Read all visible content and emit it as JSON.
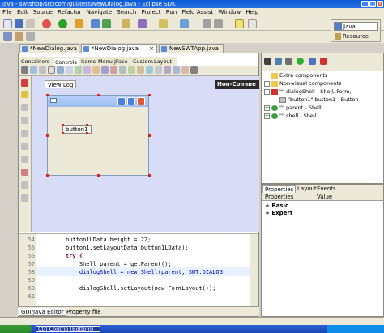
{
  "window": {
    "title": "Java - swtshop/src/com/gui/test/NewDialog.java - Eclipse SDK"
  },
  "menu": [
    "File",
    "Edit",
    "Source",
    "Refactor",
    "Navigate",
    "Search",
    "Project",
    "Run",
    "Field Assist",
    "Window",
    "Help"
  ],
  "perspectives": {
    "java": "Java",
    "resource": "Resource"
  },
  "editor_tabs": [
    "*NewDialog.java",
    "*NewDialog.java",
    "NewSWTApp.java"
  ],
  "palette_tabs": [
    "Containers",
    "Controls",
    "Items",
    "Menu",
    "JFace",
    "Custom",
    "Layout"
  ],
  "canvas": {
    "view_log_label": "View Log",
    "non_commercial_label": "Non-Comme",
    "button_label": "button1"
  },
  "code": {
    "lines": [
      {
        "num": "54",
        "text": "button1LData.height = 22;"
      },
      {
        "num": "55",
        "text": "button1.setLayoutData(button1LData);"
      },
      {
        "num": "56",
        "text": "try {"
      },
      {
        "num": "57",
        "text": "    Shell parent = getParent();"
      },
      {
        "num": "58",
        "text": "    dialogShell = new Shell(parent, SWT.DIALOG"
      },
      {
        "num": "59",
        "text": ""
      },
      {
        "num": "60",
        "text": "    dialogShell.setLayout(new FormLayout());"
      },
      {
        "num": "61",
        "text": ""
      }
    ]
  },
  "bottom_tabs": [
    "GUI/Java Editor",
    "Property file"
  ],
  "tree": {
    "items": [
      {
        "label": "Extra components",
        "expander": ""
      },
      {
        "label": "Non-visual components",
        "expander": "+"
      },
      {
        "label": "\"\" dialogShell - Shell, Form,",
        "expander": "-"
      },
      {
        "label": "\"button1\" button1 - Button",
        "expander": ""
      },
      {
        "label": "\"\" parent - Shell",
        "expander": "+"
      },
      {
        "label": "\"\" shell - Shell",
        "expander": "+"
      }
    ]
  },
  "properties": {
    "tabs": [
      "Properties",
      "Layout",
      "Events"
    ],
    "headers": [
      "Properties",
      "Value"
    ],
    "rows": [
      {
        "expander": "+",
        "label": "Basic"
      },
      {
        "expander": "+",
        "label": "Expert"
      }
    ]
  },
  "taskbar": {
    "task_label": "Ctrl Contrib (Bottom)"
  }
}
